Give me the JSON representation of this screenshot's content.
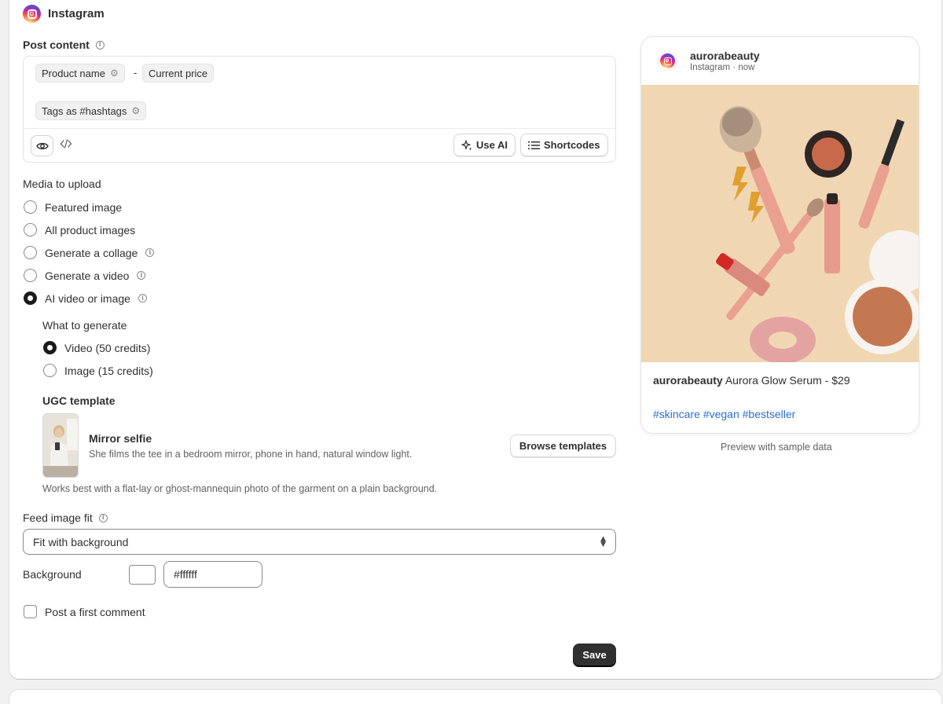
{
  "header": {
    "title": "Instagram"
  },
  "post_content": {
    "label": "Post content",
    "chips": {
      "product_name": "Product name",
      "current_price": "Current price",
      "tags": "Tags as #hashtags",
      "separator": "-"
    },
    "toolbar": {
      "use_ai": "Use AI",
      "shortcodes": "Shortcodes"
    }
  },
  "media": {
    "label": "Media to upload",
    "options": [
      {
        "label": "Featured image",
        "selected": false,
        "info": false
      },
      {
        "label": "All product images",
        "selected": false,
        "info": false
      },
      {
        "label": "Generate a collage",
        "selected": false,
        "info": true
      },
      {
        "label": "Generate a video",
        "selected": false,
        "info": true
      },
      {
        "label": "AI video or image",
        "selected": true,
        "info": true
      }
    ],
    "what_label": "What to generate",
    "generate_options": [
      {
        "label": "Video (50 credits)",
        "selected": true
      },
      {
        "label": "Image (15 credits)",
        "selected": false
      }
    ]
  },
  "ugc": {
    "label": "UGC template",
    "template_name": "Mirror selfie",
    "template_desc": "She films the tee in a bedroom mirror, phone in hand, natural window light.",
    "browse_label": "Browse templates",
    "hint": "Works best with a flat-lay or ghost-mannequin photo of the garment on a plain background."
  },
  "feed_fit": {
    "label": "Feed image fit",
    "value": "Fit with background"
  },
  "background": {
    "label": "Background",
    "value": "#ffffff",
    "swatch_color": "#ffffff"
  },
  "first_comment": {
    "label": "Post a first comment",
    "checked": false
  },
  "save_label": "Save",
  "preview": {
    "username": "aurorabeauty",
    "meta": "Instagram · now",
    "caption_user": "aurorabeauty",
    "caption_text": "Aurora Glow Serum - $29",
    "hashtags": "#skincare #vegan #bestseller",
    "note": "Preview with sample data"
  },
  "colors": {
    "accent": "#303030",
    "link": "#2c6ecb",
    "image_bg": "#f1d6b3"
  }
}
